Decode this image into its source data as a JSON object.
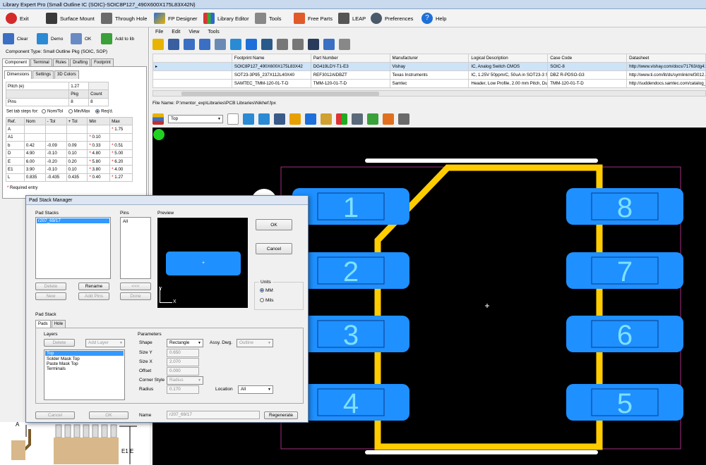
{
  "window": {
    "title": "Library Expert Pro (Small Outline IC (SOIC)-SOIC8P127_490X600X175L83X42N)"
  },
  "main_toolbar": [
    {
      "label": "Exit",
      "icon": "power-icon"
    },
    {
      "label": "Surface Mount",
      "icon": "chip-icon"
    },
    {
      "label": "Through Hole",
      "icon": "through-hole-icon"
    },
    {
      "label": "FP Designer",
      "icon": "designer-icon"
    },
    {
      "label": "Library Editor",
      "icon": "library-icon"
    },
    {
      "label": "Tools",
      "icon": "tools-icon"
    },
    {
      "label": "Free Parts",
      "icon": "cart-icon"
    },
    {
      "label": "LEAP",
      "icon": "leap-icon"
    },
    {
      "label": "Preferences",
      "icon": "gear-icon"
    },
    {
      "label": "Help",
      "icon": "help-icon"
    }
  ],
  "left": {
    "buttons": {
      "clear": "Clear",
      "demo": "Demo",
      "ok": "OK",
      "add_to_lib": "Add to lib"
    },
    "component_type": "Component Type: Small Outline Pkg (SOIC, SOP)",
    "tabs": [
      "Component",
      "Terminal",
      "Rules",
      "Drafting",
      "Footprint"
    ],
    "subtabs": [
      "Dimensions",
      "Settings",
      "3D Colors"
    ],
    "pitch_label": "Pitch (e)",
    "pitch_value": "1.27",
    "pkg_label": "Pkg",
    "count_label": "Count",
    "pins_label": "Pins",
    "pins_pkg": "8",
    "pins_count": "8",
    "tab_steps_label": "Set tab steps for:",
    "radio_nom": "Nom/Tol",
    "radio_minmax": "Min/Max",
    "radio_reqd": "Req'd.",
    "dim_headers": [
      "Ref.",
      "Nom",
      "- Tol",
      "+ Tol",
      "Min",
      "Max"
    ],
    "dim_rows": [
      [
        "A",
        "",
        "",
        "",
        "",
        "1.75"
      ],
      [
        "A1",
        "",
        "",
        "",
        "0.10",
        ""
      ],
      [
        "b",
        "0.42",
        "-0.09",
        "0.09",
        "0.33",
        "0.51"
      ],
      [
        "D",
        "4.90",
        "-0.10",
        "0.10",
        "4.80",
        "5.00"
      ],
      [
        "E",
        "6.00",
        "-0.20",
        "0.20",
        "5.80",
        "6.20"
      ],
      [
        "E1",
        "3.90",
        "-0.10",
        "0.10",
        "3.80",
        "4.00"
      ],
      [
        "L",
        "0.835",
        "-0.435",
        "0.435",
        "0.40",
        "1.27"
      ]
    ],
    "required_entry": "Required entry",
    "drawing_labels": {
      "a": "A",
      "e1e": "E1 E"
    }
  },
  "right": {
    "menu": [
      "File",
      "Edit",
      "View",
      "Tools"
    ],
    "table_headers": [
      "Footprint Name",
      "Part Number",
      "Manufacturer",
      "Logical Description",
      "Case Code",
      "Datasheet"
    ],
    "table_rows": [
      [
        "SOIC8P127_490X600X175L83X42",
        "DG419LDY-T1-E3",
        "Vishay",
        "IC, Analog Switch CMOS",
        "SOIC-8",
        "http://www.vishay.com/docs/71763/dg417l.pdf"
      ],
      [
        "SOT23-3P95_237X112L40X40",
        "REF3012AIDBZT",
        "Texas Instruments",
        "IC, 1.25V 50ppm/C, 50uA in SOT23-3 Series (Bandgap) Voltage Reference",
        "DBZ R-PDSO-G3",
        "http://www.ti.com/lit/ds/symlink/ref3012.pdf"
      ],
      [
        "SAMTEC_TMM-120-01-T-D",
        "TMM-120-01-T-D",
        "Samtec",
        "Header, Low Profile, 2.00 mm Pitch, Dual Row, 40-Position, Through-hole",
        "TMM-120-01-T-D",
        "http://suddendocs.samtec.com/catalog_english/tmm_th.pdf"
      ]
    ],
    "file_name": "File Name:  P:\\mentor_exp\\Libraries\\PCB Libraries\\Nikhef.fpx",
    "layer_select": "Top",
    "pads_left": [
      "1",
      "2",
      "3",
      "4"
    ],
    "pads_right": [
      "8",
      "7",
      "6",
      "5"
    ]
  },
  "dialog": {
    "title": "Pad Stack Manager",
    "pad_stacks_label": "Pad Stacks",
    "pad_stacks_items": [
      "r207_69/17"
    ],
    "pins_label": "Pins",
    "pins_items": [
      "All"
    ],
    "preview_label": "Preview",
    "preview_axis_y": "Y",
    "preview_axis_x": "X",
    "ok": "OK",
    "cancel": "Cancel",
    "units_label": "Units",
    "unit_mm": "MM",
    "unit_mils": "Mils",
    "btn_delete": "Delete",
    "btn_rename": "Rename",
    "btn_prev": "<<<",
    "btn_new": "New",
    "btn_add_pins": "Add Pins",
    "btn_done": "Done",
    "pad_stack_group": "Pad Stack",
    "tabs": [
      "Pads",
      "Hole"
    ],
    "layers_label": "Layers",
    "layers_delete": "Delete",
    "add_layer": "Add Layer",
    "layers": [
      "Top",
      "Solder Mask Top",
      "Paste Mask Top",
      "Terminals"
    ],
    "parameters_label": "Parameters",
    "shape_label": "Shape",
    "shape_value": "Rectangle",
    "assy_label": "Assy. Dwg.",
    "assy_value": "Outline",
    "size_y_label": "Size Y",
    "size_y_value": "0.650",
    "size_x_label": "Size X",
    "size_x_value": "2.070",
    "offset_label": "Offset",
    "offset_value": "0.000",
    "corner_label": "Corner Style",
    "corner_value": "Radius",
    "radius_label": "Radius",
    "radius_value": "0.170",
    "location_label": "Location",
    "location_value": "All",
    "bottom_cancel": "Cancel",
    "bottom_ok": "OK",
    "name_label": "Name",
    "name_value": "r207_69/17",
    "regenerate": "Regenerate"
  },
  "colors": {
    "pad": "#1e90ff",
    "outline": "#ffcc00",
    "silk": "#ffffff",
    "courtyard": "#a0317e",
    "annotation": "#e02020"
  }
}
